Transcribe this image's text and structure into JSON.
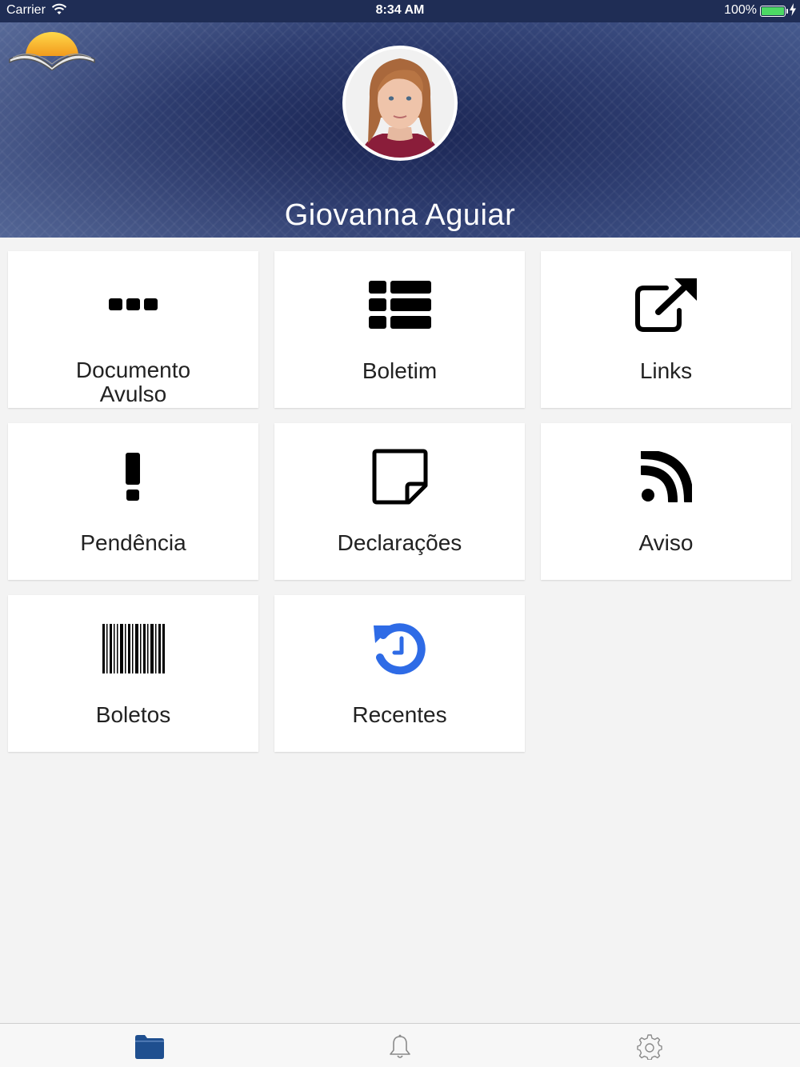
{
  "status_bar": {
    "carrier": "Carrier",
    "time": "8:34 AM",
    "battery": "100%"
  },
  "header": {
    "student_name": "Giovanna Aguiar"
  },
  "menu": [
    {
      "label_line1": "Documento",
      "label_line2": "Avulso",
      "icon": "ellipsis-icon"
    },
    {
      "label": "Boletim",
      "icon": "list-icon"
    },
    {
      "label": "Links",
      "icon": "external-link-icon"
    },
    {
      "label": "Pendência",
      "icon": "exclamation-icon"
    },
    {
      "label": "Declarações",
      "icon": "sticky-note-icon"
    },
    {
      "label": "Aviso",
      "icon": "rss-icon"
    },
    {
      "label": "Boletos",
      "icon": "barcode-icon"
    },
    {
      "label": "Recentes",
      "icon": "history-icon"
    }
  ],
  "tab_bar": {
    "tabs": [
      {
        "icon": "folder-icon",
        "active": true
      },
      {
        "icon": "bell-icon",
        "active": false
      },
      {
        "icon": "gear-icon",
        "active": false
      }
    ]
  },
  "colors": {
    "accent": "#1f4f8f",
    "history_icon": "#2e6be6",
    "battery": "#4cd964"
  }
}
